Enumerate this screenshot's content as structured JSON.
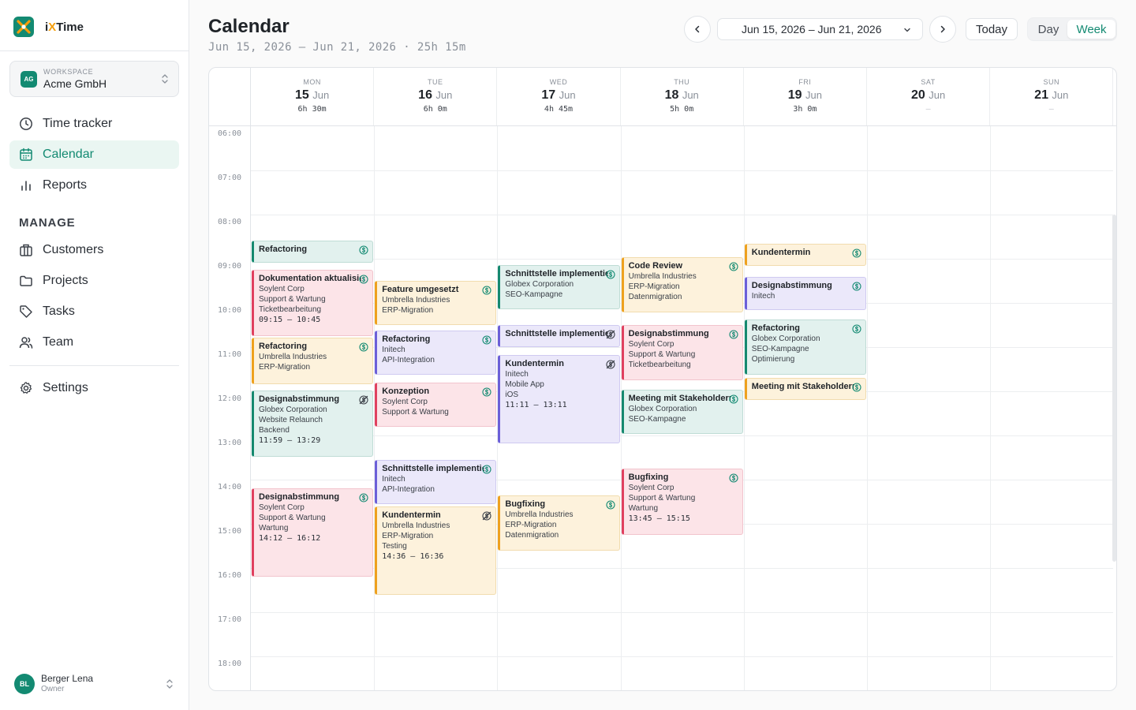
{
  "app": {
    "name_prefix": "i",
    "name_x": "X",
    "name_suffix": "Time"
  },
  "workspace": {
    "label": "WORKSPACE",
    "name": "Acme GmbH",
    "badge": "AG"
  },
  "nav": {
    "time_tracker": "Time tracker",
    "calendar": "Calendar",
    "reports": "Reports",
    "manage_label": "MANAGE",
    "customers": "Customers",
    "projects": "Projects",
    "tasks": "Tasks",
    "team": "Team",
    "settings": "Settings"
  },
  "user": {
    "initials": "BL",
    "name": "Berger Lena",
    "role": "Owner"
  },
  "header": {
    "title": "Calendar",
    "subtitle": "Jun 15, 2026 – Jun 21, 2026 · 25h 15m",
    "range": "Jun 15, 2026 – Jun 21, 2026",
    "today": "Today",
    "day": "Day",
    "week": "Week"
  },
  "colors": {
    "accent": "#138a72",
    "green": "#15896f",
    "yellow": "#eea11e",
    "purple": "#6b5fd8",
    "red": "#e0405f"
  },
  "days": [
    {
      "dow": "MON",
      "num": "15",
      "mon": "Jun",
      "total": "6h 30m"
    },
    {
      "dow": "TUE",
      "num": "16",
      "mon": "Jun",
      "total": "6h 0m"
    },
    {
      "dow": "WED",
      "num": "17",
      "mon": "Jun",
      "total": "4h 45m"
    },
    {
      "dow": "THU",
      "num": "18",
      "mon": "Jun",
      "total": "5h 0m"
    },
    {
      "dow": "FRI",
      "num": "19",
      "mon": "Jun",
      "total": "3h 0m"
    },
    {
      "dow": "SAT",
      "num": "20",
      "mon": "Jun",
      "total": "–"
    },
    {
      "dow": "SUN",
      "num": "21",
      "mon": "Jun",
      "total": "–"
    }
  ],
  "hours": [
    "06:00",
    "07:00",
    "08:00",
    "09:00",
    "10:00",
    "11:00",
    "12:00",
    "13:00",
    "14:00",
    "15:00",
    "16:00",
    "17:00",
    "18:00"
  ],
  "events": [
    {
      "day": 0,
      "start": "08:35",
      "end": "09:05",
      "color": "green",
      "billable": true,
      "title": "Refactoring",
      "lines": [],
      "time": ""
    },
    {
      "day": 0,
      "start": "09:15",
      "end": "10:45",
      "color": "red",
      "billable": true,
      "title": "Dokumentation aktualisieren",
      "lines": [
        "Soylent Corp",
        "Support & Wartung",
        "Ticketbearbeitung"
      ],
      "time": "09:15 – 10:45"
    },
    {
      "day": 0,
      "start": "10:47",
      "end": "11:50",
      "color": "yellow",
      "billable": true,
      "title": "Refactoring",
      "lines": [
        "Umbrella Industries",
        "ERP-Migration"
      ],
      "time": ""
    },
    {
      "day": 0,
      "start": "11:59",
      "end": "13:29",
      "color": "green",
      "billable": false,
      "title": "Designabstimmung",
      "lines": [
        "Globex Corporation",
        "Website Relaunch",
        "Backend"
      ],
      "time": "11:59 – 13:29"
    },
    {
      "day": 0,
      "start": "14:12",
      "end": "16:12",
      "color": "red",
      "billable": true,
      "title": "Designabstimmung",
      "lines": [
        "Soylent Corp",
        "Support & Wartung",
        "Wartung"
      ],
      "time": "14:12 – 16:12"
    },
    {
      "day": 1,
      "start": "09:30",
      "end": "10:30",
      "color": "yellow",
      "billable": true,
      "title": "Feature umgesetzt",
      "lines": [
        "Umbrella Industries",
        "ERP-Migration"
      ],
      "time": ""
    },
    {
      "day": 1,
      "start": "10:38",
      "end": "11:38",
      "color": "purple",
      "billable": true,
      "title": "Refactoring",
      "lines": [
        "Initech",
        "API-Integration"
      ],
      "time": ""
    },
    {
      "day": 1,
      "start": "11:48",
      "end": "12:48",
      "color": "red",
      "billable": true,
      "title": "Konzeption",
      "lines": [
        "Soylent Corp",
        "Support & Wartung"
      ],
      "time": ""
    },
    {
      "day": 1,
      "start": "13:33",
      "end": "14:33",
      "color": "purple",
      "billable": true,
      "title": "Schnittstelle implementieren",
      "lines": [
        "Initech",
        "API-Integration"
      ],
      "time": ""
    },
    {
      "day": 1,
      "start": "14:36",
      "end": "16:36",
      "color": "yellow",
      "billable": false,
      "title": "Kundentermin",
      "lines": [
        "Umbrella Industries",
        "ERP-Migration",
        "Testing"
      ],
      "time": "14:36 – 16:36"
    },
    {
      "day": 2,
      "start": "09:09",
      "end": "10:09",
      "color": "green",
      "billable": true,
      "title": "Schnittstelle implementieren",
      "lines": [
        "Globex Corporation",
        "SEO-Kampagne"
      ],
      "time": ""
    },
    {
      "day": 2,
      "start": "10:30",
      "end": "11:00",
      "color": "purple",
      "billable": false,
      "title": "Schnittstelle implementieren",
      "lines": [],
      "time": ""
    },
    {
      "day": 2,
      "start": "11:11",
      "end": "13:11",
      "color": "purple",
      "billable": false,
      "title": "Kundentermin",
      "lines": [
        "Initech",
        "Mobile App",
        "iOS"
      ],
      "time": "11:11 – 13:11"
    },
    {
      "day": 2,
      "start": "14:21",
      "end": "15:36",
      "color": "yellow",
      "billable": true,
      "title": "Bugfixing",
      "lines": [
        "Umbrella Industries",
        "ERP-Migration",
        "Datenmigration"
      ],
      "time": ""
    },
    {
      "day": 3,
      "start": "08:58",
      "end": "10:13",
      "color": "yellow",
      "billable": true,
      "title": "Code Review",
      "lines": [
        "Umbrella Industries",
        "ERP-Migration",
        "Datenmigration"
      ],
      "time": ""
    },
    {
      "day": 3,
      "start": "10:30",
      "end": "11:45",
      "color": "red",
      "billable": true,
      "title": "Designabstimmung",
      "lines": [
        "Soylent Corp",
        "Support & Wartung",
        "Ticketbearbeitung"
      ],
      "time": ""
    },
    {
      "day": 3,
      "start": "11:58",
      "end": "12:58",
      "color": "green",
      "billable": true,
      "title": "Meeting mit Stakeholdern",
      "lines": [
        "Globex Corporation",
        "SEO-Kampagne"
      ],
      "time": ""
    },
    {
      "day": 3,
      "start": "13:45",
      "end": "15:15",
      "color": "red",
      "billable": true,
      "title": "Bugfixing",
      "lines": [
        "Soylent Corp",
        "Support & Wartung",
        "Wartung"
      ],
      "time": "13:45 – 15:15"
    },
    {
      "day": 4,
      "start": "08:40",
      "end": "09:10",
      "color": "yellow",
      "billable": true,
      "title": "Kundentermin",
      "lines": [],
      "time": ""
    },
    {
      "day": 4,
      "start": "09:25",
      "end": "10:10",
      "color": "purple",
      "billable": true,
      "title": "Designabstimmung",
      "lines": [
        "Initech"
      ],
      "time": ""
    },
    {
      "day": 4,
      "start": "10:22",
      "end": "11:37",
      "color": "green",
      "billable": true,
      "title": "Refactoring",
      "lines": [
        "Globex Corporation",
        "SEO-Kampagne",
        "Optimierung"
      ],
      "time": ""
    },
    {
      "day": 4,
      "start": "11:42",
      "end": "12:12",
      "color": "yellow",
      "billable": true,
      "title": "Meeting mit Stakeholdern",
      "lines": [],
      "time": ""
    }
  ]
}
